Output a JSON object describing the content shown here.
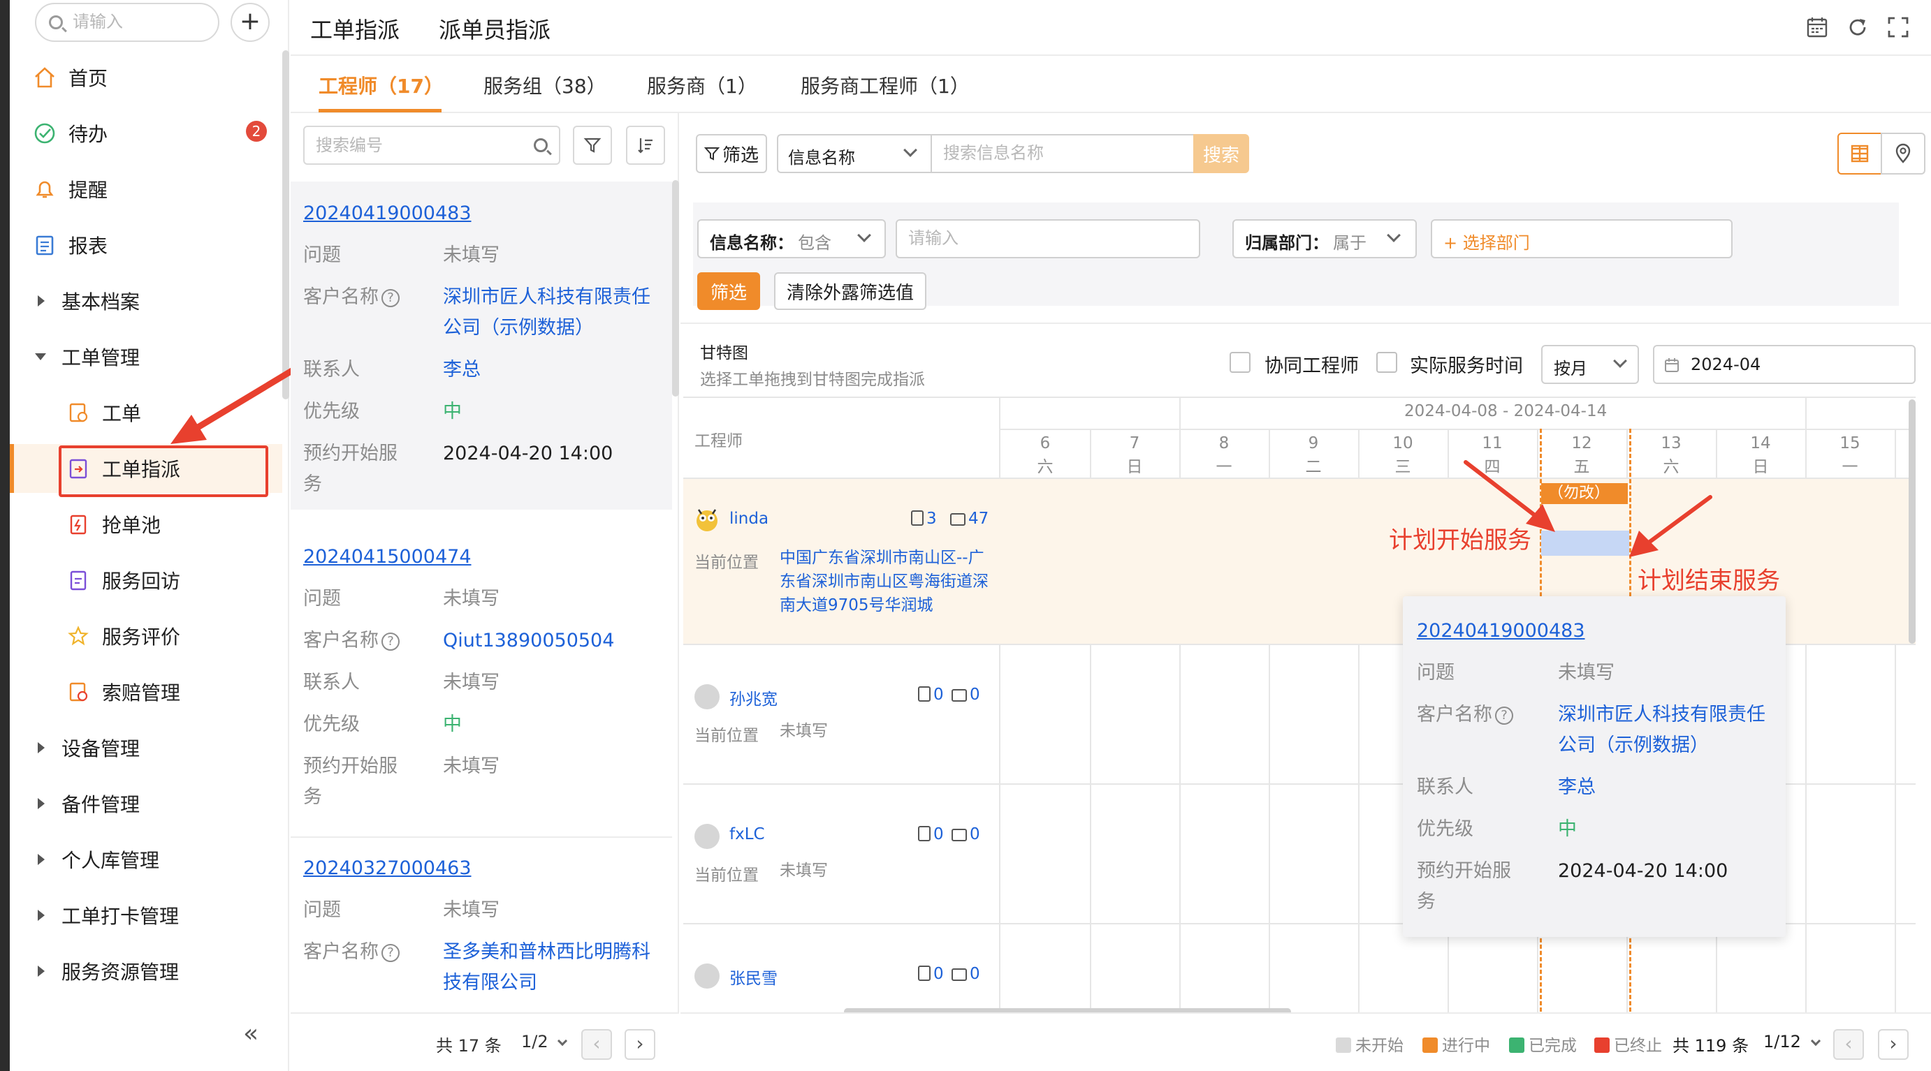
{
  "colors": {
    "accent": "#f08b2a",
    "link": "#1d61d8",
    "priority_mid": "#3cb371",
    "badge": "#e34a3b",
    "annotation": "#e8402e",
    "status_not_started": "#d9d9d9",
    "status_in_progress": "#f08b2a",
    "status_done": "#3cb371",
    "status_terminated": "#e8402e"
  },
  "sidebar": {
    "search_placeholder": "请输入",
    "add_icon": "plus-icon",
    "items": [
      {
        "label": "首页",
        "icon": "home-icon"
      },
      {
        "label": "待办",
        "icon": "check-circle-icon",
        "badge": "2"
      },
      {
        "label": "提醒",
        "icon": "bell-icon"
      },
      {
        "label": "报表",
        "icon": "report-icon"
      },
      {
        "label": "基本档案",
        "icon": "caret-right-icon"
      },
      {
        "label": "工单管理",
        "icon": "caret-down-icon"
      },
      {
        "label": "工单",
        "icon": "order-icon"
      },
      {
        "label": "工单指派",
        "icon": "assign-icon",
        "active": true
      },
      {
        "label": "抢单池",
        "icon": "grab-pool-icon"
      },
      {
        "label": "服务回访",
        "icon": "revisit-icon"
      },
      {
        "label": "服务评价",
        "icon": "rating-icon"
      },
      {
        "label": "索赔管理",
        "icon": "claim-icon"
      },
      {
        "label": "设备管理",
        "icon": "caret-right-icon"
      },
      {
        "label": "备件管理",
        "icon": "caret-right-icon"
      },
      {
        "label": "个人库管理",
        "icon": "caret-right-icon"
      },
      {
        "label": "工单打卡管理",
        "icon": "caret-right-icon"
      },
      {
        "label": "服务资源管理",
        "icon": "caret-right-icon"
      }
    ],
    "collapse_label": "«"
  },
  "header": {
    "tabs": [
      "工单指派",
      "派单员指派"
    ],
    "icons": [
      "calendar-icon",
      "refresh-icon",
      "fullscreen-icon"
    ]
  },
  "resource_tabs": [
    {
      "label": "工程师（17）",
      "active": true
    },
    {
      "label": "服务组（38）"
    },
    {
      "label": "服务商（1）"
    },
    {
      "label": "服务商工程师（1）"
    }
  ],
  "order_list": {
    "search_placeholder": "搜索编号",
    "cards": [
      {
        "number": "20240419000483",
        "problem_label": "问题",
        "problem": "未填写",
        "customer_label": "客户名称",
        "customer": "深圳市匠人科技有限责任公司（示例数据）",
        "contact_label": "联系人",
        "contact": "李总",
        "priority_label": "优先级",
        "priority": "中",
        "start_label": "预约开始服务",
        "start": "2024-04-20 14:00"
      },
      {
        "number": "20240415000474",
        "problem_label": "问题",
        "problem": "未填写",
        "customer_label": "客户名称",
        "customer": "Qiut13890050504",
        "contact_label": "联系人",
        "contact": "未填写",
        "priority_label": "优先级",
        "priority": "中",
        "start_label": "预约开始服务",
        "start": "未填写"
      },
      {
        "number": "20240327000463",
        "problem_label": "问题",
        "problem": "未填写",
        "customer_label": "客户名称",
        "customer": "圣多美和普林西比明腾科技有限公司"
      }
    ],
    "footer": {
      "total": "共 17 条",
      "page": "1/2"
    }
  },
  "toolbar": {
    "filter_label": "筛选",
    "field_select": "信息名称",
    "search_placeholder": "搜索信息名称",
    "search_button": "搜索",
    "view_icons": [
      "gantt-view-icon",
      "map-pin-icon"
    ]
  },
  "filter_panel": {
    "field1_label": "信息名称：",
    "field1_op": "包含",
    "field1_placeholder": "请输入",
    "field2_label": "归属部门：",
    "field2_op": "属于",
    "field2_button": "+ 选择部门",
    "apply": "筛选",
    "clear": "清除外露筛选值"
  },
  "gantt": {
    "title": "甘特图",
    "subtitle": "选择工单拖拽到甘特图完成指派",
    "opt_collab": "协同工程师",
    "opt_actual": "实际服务时间",
    "period": "按月",
    "date": "2024-04",
    "week_range": "2024-04-08 - 2024-04-14",
    "engineer_col": "工程师",
    "days": [
      {
        "d": "6",
        "w": "六"
      },
      {
        "d": "7",
        "w": "日"
      },
      {
        "d": "8",
        "w": "一"
      },
      {
        "d": "9",
        "w": "二"
      },
      {
        "d": "10",
        "w": "三"
      },
      {
        "d": "11",
        "w": "四"
      },
      {
        "d": "12",
        "w": "五"
      },
      {
        "d": "13",
        "w": "六"
      },
      {
        "d": "14",
        "w": "日"
      },
      {
        "d": "15",
        "w": "一"
      }
    ],
    "engineers": [
      {
        "name": "linda",
        "orders": "3",
        "days": "47",
        "loc_label": "当前位置",
        "location": "中国广东省深圳市南山区--广东省深圳市南山区粤海街道深南大道9705号华润城"
      },
      {
        "name": "孙兆宽",
        "orders": "0",
        "days": "0",
        "loc_label": "当前位置",
        "location": "未填写"
      },
      {
        "name": "fxLC",
        "orders": "0",
        "days": "0",
        "loc_label": "当前位置",
        "location": "未填写"
      },
      {
        "name": "张民雪",
        "orders": "0",
        "days": "0"
      }
    ],
    "task_bar_label": "（勿改）",
    "annotation_start": "计划开始服务",
    "annotation_end": "计划结束服务",
    "popup": {
      "number": "20240419000483",
      "problem_label": "问题",
      "problem": "未填写",
      "customer_label": "客户名称",
      "customer": "深圳市匠人科技有限责任公司（示例数据）",
      "contact_label": "联系人",
      "contact": "李总",
      "priority_label": "优先级",
      "priority": "中",
      "start_label": "预约开始服务",
      "start": "2024-04-20 14:00"
    },
    "legend": [
      "未开始",
      "进行中",
      "已完成",
      "已终止"
    ],
    "footer": {
      "total": "共 119 条",
      "page": "1/12"
    }
  }
}
